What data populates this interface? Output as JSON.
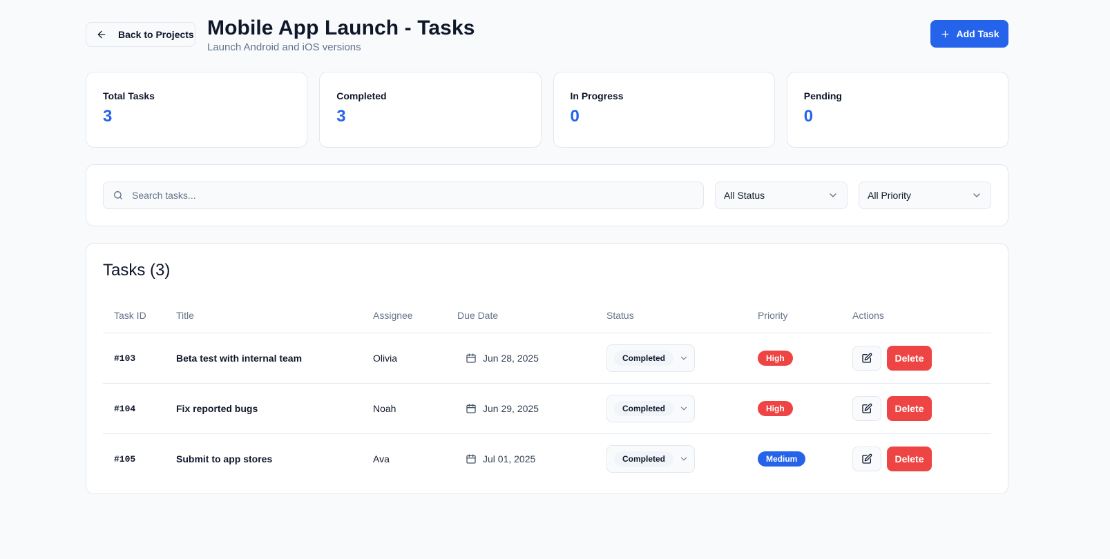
{
  "header": {
    "back_label": "Back to Projects",
    "title": "Mobile App Launch - Tasks",
    "subtitle": "Launch Android and iOS versions",
    "add_label": "Add Task"
  },
  "stats": [
    {
      "label": "Total Tasks",
      "value": "3"
    },
    {
      "label": "Completed",
      "value": "3"
    },
    {
      "label": "In Progress",
      "value": "0"
    },
    {
      "label": "Pending",
      "value": "0"
    }
  ],
  "filters": {
    "search_placeholder": "Search tasks...",
    "search_value": "",
    "status_selected": "All Status",
    "priority_selected": "All Priority"
  },
  "tasks": {
    "heading": "Tasks (3)",
    "columns": {
      "id": "Task ID",
      "title": "Title",
      "assignee": "Assignee",
      "due": "Due Date",
      "status": "Status",
      "priority": "Priority",
      "actions": "Actions"
    },
    "rows": [
      {
        "id": "#103",
        "title": "Beta test with internal team",
        "assignee": "Olivia",
        "due": "Jun 28, 2025",
        "status": "Completed",
        "priority": "High",
        "priority_color": "#ef4444",
        "delete_label": "Delete"
      },
      {
        "id": "#104",
        "title": "Fix reported bugs",
        "assignee": "Noah",
        "due": "Jun 29, 2025",
        "status": "Completed",
        "priority": "High",
        "priority_color": "#ef4444",
        "delete_label": "Delete"
      },
      {
        "id": "#105",
        "title": "Submit to app stores",
        "assignee": "Ava",
        "due": "Jul 01, 2025",
        "status": "Completed",
        "priority": "Medium",
        "priority_color": "#2563eb",
        "delete_label": "Delete"
      }
    ]
  },
  "colors": {
    "accent": "#2563eb",
    "danger": "#ef4444",
    "background": "#f8fafc"
  },
  "icons": {
    "back": "arrow-left-icon",
    "add": "plus-icon",
    "search": "search-icon",
    "dropdown": "chevron-down-icon",
    "calendar": "calendar-icon",
    "edit": "edit-icon"
  }
}
